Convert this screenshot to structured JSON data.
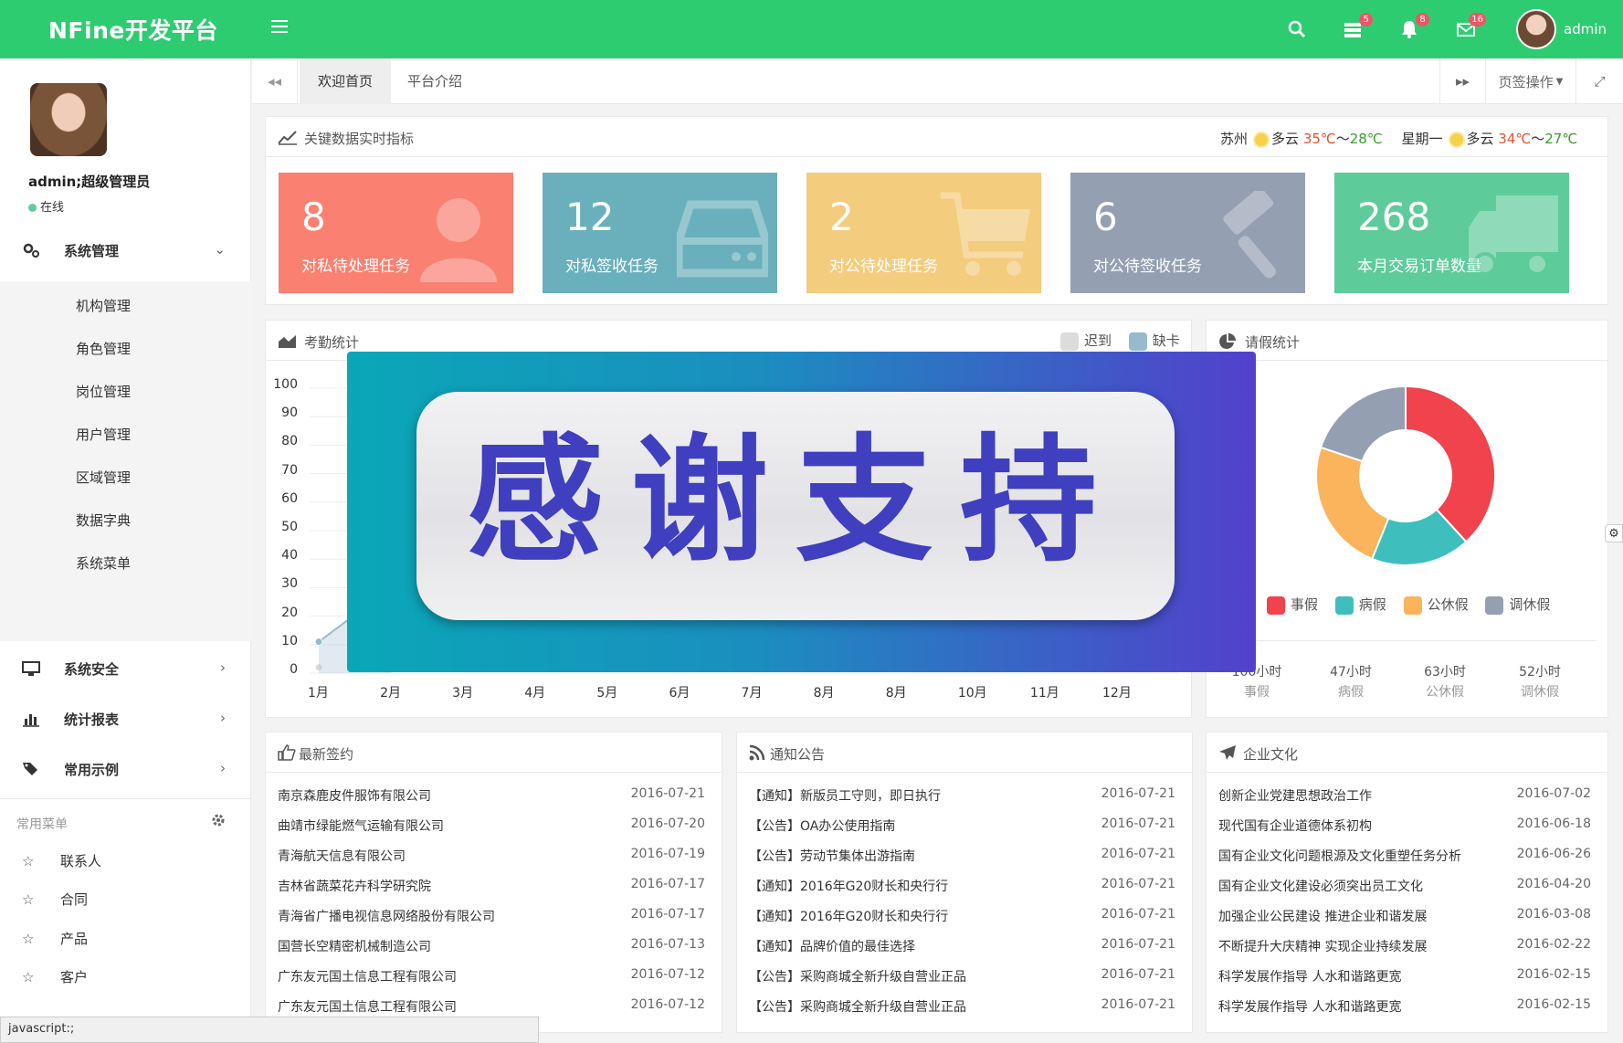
{
  "header": {
    "brand": "NFine开发平台",
    "badges": {
      "tasks": "5",
      "notifications": "8",
      "messages": "16"
    },
    "user": "admin"
  },
  "sidebar": {
    "profile_name": "admin;超级管理员",
    "status": "在线",
    "groups": [
      {
        "label": "系统管理",
        "icon": "gears-icon",
        "expanded": true
      },
      {
        "label": "系统安全",
        "icon": "desktop-icon"
      },
      {
        "label": "统计报表",
        "icon": "bar-chart-icon"
      },
      {
        "label": "常用示例",
        "icon": "tags-icon"
      }
    ],
    "system_items": [
      "机构管理",
      "角色管理",
      "岗位管理",
      "用户管理",
      "区域管理",
      "数据字典",
      "系统菜单"
    ],
    "common_title": "常用菜单",
    "common_items": [
      "联系人",
      "合同",
      "产品",
      "客户"
    ]
  },
  "tabs": {
    "items": [
      "欢迎首页",
      "平台介绍"
    ],
    "active": "欢迎首页",
    "page_ops": "页签操作"
  },
  "kpi": {
    "title": "关键数据实时指标",
    "weather": {
      "city": "苏州",
      "today": {
        "cond": "多云",
        "hi": "35℃",
        "sep": "～",
        "lo": "28℃"
      },
      "day": "星期一",
      "tomorrow": {
        "cond": "多云",
        "hi": "34℃",
        "sep": "～",
        "lo": "27℃"
      }
    },
    "cards": [
      {
        "value": "8",
        "label": "对私待处理任务",
        "color": "#fa8072",
        "icon": "user-icon"
      },
      {
        "value": "12",
        "label": "对私签收任务",
        "color": "#6ab0bc",
        "icon": "hdd-icon"
      },
      {
        "value": "2",
        "label": "对公待处理任务",
        "color": "#f4cc7e",
        "icon": "cart-icon"
      },
      {
        "value": "6",
        "label": "对公待签收任务",
        "color": "#94a0b2",
        "icon": "gavel-icon"
      },
      {
        "value": "268",
        "label": "本月交易订单数量",
        "color": "#5ecb9a",
        "icon": "truck-icon"
      }
    ]
  },
  "attendance": {
    "title": "考勤统计",
    "legend": [
      "迟到",
      "缺卡"
    ],
    "legend_colors": [
      "#dcdcdc",
      "#97bbcd"
    ]
  },
  "chart_data": {
    "type": "area",
    "title": "考勤统计",
    "y_ticks": [
      "100",
      "90",
      "80",
      "70",
      "60",
      "50",
      "40",
      "30",
      "20",
      "10",
      "0"
    ],
    "x_ticks": [
      "1月",
      "2月",
      "3月",
      "4月",
      "5月",
      "6月",
      "7月",
      "8月",
      "8月",
      "10月",
      "11月",
      "12月"
    ],
    "ylim": [
      0,
      100
    ],
    "series": [
      {
        "name": "迟到",
        "color": "#dcdcdc",
        "values": [
          2,
          null,
          null,
          null,
          null,
          null,
          null,
          null,
          null,
          null,
          null,
          null
        ]
      },
      {
        "name": "缺卡",
        "color": "#97bbcd",
        "values": [
          11,
          30,
          null,
          null,
          null,
          null,
          null,
          null,
          null,
          null,
          null,
          null
        ]
      }
    ]
  },
  "leave": {
    "title": "请假统计",
    "slices": [
      {
        "name": "事假",
        "value": 100,
        "color": "#f0434e"
      },
      {
        "name": "病假",
        "value": 47,
        "color": "#3ebfbe"
      },
      {
        "name": "公休假",
        "value": 63,
        "color": "#fbb35c"
      },
      {
        "name": "调休假",
        "value": 52,
        "color": "#949fb1"
      }
    ],
    "stats": [
      {
        "value": "100小时",
        "label": "事假"
      },
      {
        "value": "47小时",
        "label": "病假"
      },
      {
        "value": "63小时",
        "label": "公休假"
      },
      {
        "value": "52小时",
        "label": "调休假"
      }
    ]
  },
  "contracts": {
    "title": "最新签约",
    "rows": [
      {
        "text": "南京森鹿皮件服饰有限公司",
        "date": "2016-07-21"
      },
      {
        "text": "曲靖市绿能燃气运输有限公司",
        "date": "2016-07-20"
      },
      {
        "text": "青海航天信息有限公司",
        "date": "2016-07-19"
      },
      {
        "text": "吉林省蔬菜花卉科学研究院",
        "date": "2016-07-17"
      },
      {
        "text": "青海省广播电视信息网络股份有限公司",
        "date": "2016-07-17"
      },
      {
        "text": "国营长空精密机械制造公司",
        "date": "2016-07-13"
      },
      {
        "text": "广东友元国土信息工程有限公司",
        "date": "2016-07-12"
      },
      {
        "text": "广东友元国土信息工程有限公司",
        "date": "2016-07-12"
      }
    ]
  },
  "notices": {
    "title": "通知公告",
    "rows": [
      {
        "text": "【通知】新版员工守则，即日执行",
        "date": "2016-07-21"
      },
      {
        "text": "【公告】OA办公使用指南",
        "date": "2016-07-21"
      },
      {
        "text": "【公告】劳动节集体出游指南",
        "date": "2016-07-21"
      },
      {
        "text": "【通知】2016年G20财长和央行行",
        "date": "2016-07-21"
      },
      {
        "text": "【通知】2016年G20财长和央行行",
        "date": "2016-07-21"
      },
      {
        "text": "【通知】品牌价值的最佳选择",
        "date": "2016-07-21"
      },
      {
        "text": "【公告】采购商城全新升级自营业正品",
        "date": "2016-07-21"
      },
      {
        "text": "【公告】采购商城全新升级自营业正品",
        "date": "2016-07-21"
      }
    ]
  },
  "culture": {
    "title": "企业文化",
    "rows": [
      {
        "text": "创新企业党建思想政治工作",
        "date": "2016-07-02"
      },
      {
        "text": "现代国有企业道德体系初构",
        "date": "2016-06-18"
      },
      {
        "text": "国有企业文化问题根源及文化重塑任务分析",
        "date": "2016-06-26"
      },
      {
        "text": "国有企业文化建设必须突出员工文化",
        "date": "2016-04-20"
      },
      {
        "text": "加强企业公民建设 推进企业和谐发展",
        "date": "2016-03-08"
      },
      {
        "text": "不断提升大庆精神 实现企业持续发展",
        "date": "2016-02-22"
      },
      {
        "text": "科学发展作指导 人水和谐路更宽",
        "date": "2016-02-15"
      },
      {
        "text": "科学发展作指导 人水和谐路更宽",
        "date": "2016-02-15"
      }
    ]
  },
  "overlay": {
    "text": "感谢支持"
  },
  "statusbar": {
    "text": "javascript:;"
  }
}
